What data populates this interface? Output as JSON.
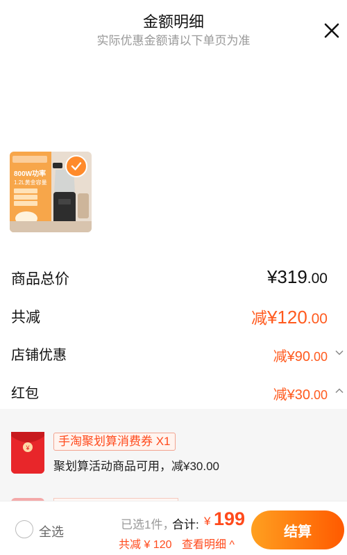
{
  "header": {
    "title": "金额明细",
    "subtitle": "实际优惠金额请以下单页为准"
  },
  "product": {
    "badge_texts": [
      "800W功率",
      "1.2L黄金容量"
    ],
    "selected": true
  },
  "summary": {
    "total_price_label": "商品总价",
    "total_price_int": "¥319",
    "total_price_dec": ".00",
    "total_discount_label": "共减",
    "total_discount_prefix": "减",
    "total_discount_int": "¥120",
    "total_discount_dec": ".00",
    "store_label": "店铺优惠",
    "store_prefix": "减",
    "store_int": "¥90",
    "store_dec": ".00",
    "redpacket_label": "红包",
    "redpacket_prefix": "减",
    "redpacket_int": "¥30",
    "redpacket_dec": ".00"
  },
  "coupons": [
    {
      "tag": "手淘聚划算消费券 X1",
      "desc": "聚划算活动商品可用，减¥30.00"
    }
  ],
  "footer": {
    "select_all": "全选",
    "selected_count": "已选1件，",
    "total_label": "合计:",
    "total_currency": "¥",
    "total_value": "199",
    "discount_text": "共减 ¥ 120",
    "view_details": "查看明细 ^",
    "checkout_label": "结算"
  },
  "colors": {
    "accent": "#ff5a1e",
    "checkout_gradient_start": "#ffa020",
    "checkout_gradient_end": "#ff5a00",
    "coupon_red": "#e8262a"
  }
}
